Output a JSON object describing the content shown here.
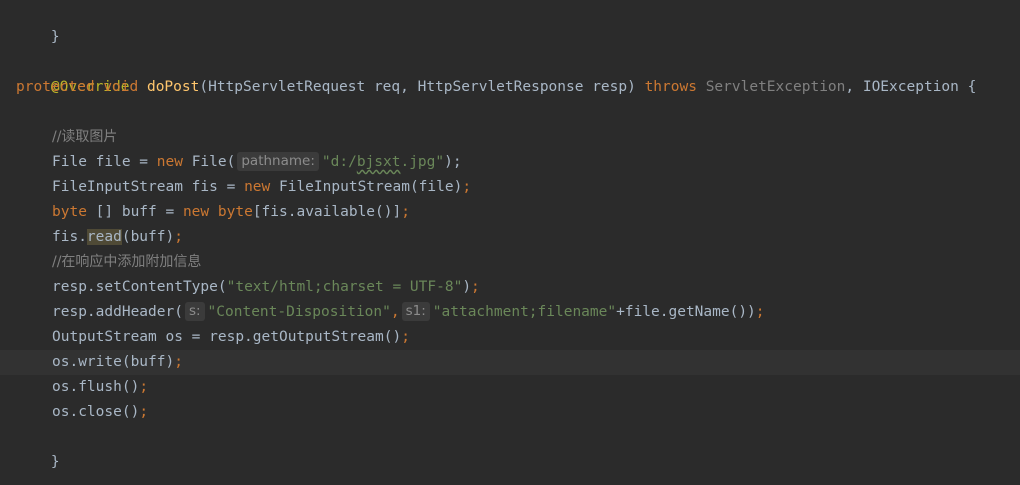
{
  "lines": {
    "l1": {
      "brace": "}"
    },
    "l3": {
      "annotation": "@Override"
    },
    "l4": {
      "kw_protected": "protected",
      "kw_void": "void",
      "method": "doPost",
      "params": "(HttpServletRequest req, HttpServletResponse resp) ",
      "kw_throws": "throws",
      "exc1": "ServletException",
      "rest": ", IOException {"
    },
    "l6": {
      "comment": "//读取图片"
    },
    "l7": {
      "a": "File file = ",
      "kw_new": "new",
      "b": " File(",
      "hint": "pathname:",
      "str_q1": "\"d:/",
      "str_word": "bjsxt",
      "str_q2": ".jpg\"",
      "end": ");"
    },
    "l8": {
      "a": "FileInputStream fis = ",
      "kw_new": "new",
      "b": " FileInputStream(file)",
      "semi": ";"
    },
    "l9": {
      "kw_byte": "byte",
      "a": " [] buff = ",
      "kw_new": "new",
      "sp": " ",
      "kw_byte2": "byte",
      "b": "[fis.available()]",
      "semi": ";"
    },
    "l10": {
      "a": "fis.",
      "method": "read",
      "b": "(buff)",
      "semi": ";"
    },
    "l11": {
      "comment": "//在响应中添加附加信息"
    },
    "l12": {
      "a": "resp.setContentType(",
      "str": "\"text/html;charset = UTF-8\"",
      "b": ")",
      "semi": ";"
    },
    "l13": {
      "a": "resp.addHeader(",
      "hint1": "s:",
      "str1": "\"Content-Disposition\"",
      "comma": ",",
      "hint2": "s1:",
      "str2": "\"attachment;filename\"",
      "b": "+file.getName())",
      "semi": ";"
    },
    "l14": {
      "a": "OutputStream os = resp.getOutputStream()",
      "semi": ";"
    },
    "l15": {
      "a": "os.write(buff)",
      "semi": ";"
    },
    "l16": {
      "a": "os.flush()",
      "semi": ";"
    },
    "l17": {
      "a": "os.close()",
      "semi": ";"
    },
    "l18": {
      "brace": "}"
    }
  }
}
